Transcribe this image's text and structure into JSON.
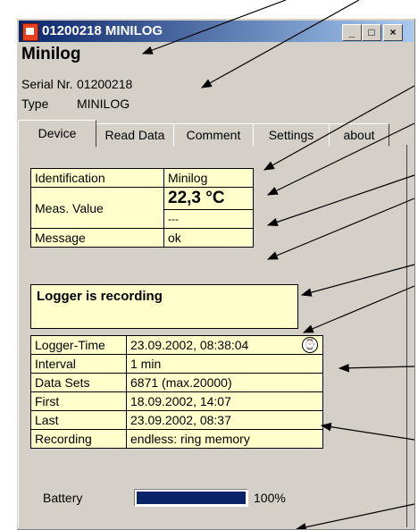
{
  "window": {
    "title": "01200218 MINILOG",
    "minimize": "_",
    "maximize": "□",
    "close": "×"
  },
  "header": {
    "name": "Minilog",
    "serial_label": "Serial Nr.",
    "serial_value": "01200218",
    "type_label": "Type",
    "type_value": "MINILOG"
  },
  "tabs": [
    "Device",
    "Read Data",
    "Comment",
    "Settings",
    "about"
  ],
  "device": {
    "identification_label": "Identification",
    "identification_value": "Minilog",
    "meas_label": "Meas. Value",
    "meas_value": "22,3 °C",
    "meas_value2": "---",
    "message_label": "Message",
    "message_value": "ok"
  },
  "status": "Logger is recording",
  "info_rows": [
    {
      "label": "Logger-Time",
      "value": "23.09.2002, 08:38:04"
    },
    {
      "label": "Interval",
      "value": "1 min"
    },
    {
      "label": "Data Sets",
      "value": "6871 (max.20000)"
    },
    {
      "label": "First",
      "value": "18.09.2002, 14:07"
    },
    {
      "label": "Last",
      "value": "23.09.2002, 08:37"
    },
    {
      "label": "Recording",
      "value": "endless: ring memory"
    }
  ],
  "battery": {
    "label": "Battery",
    "percent_text": "100%",
    "level": 1.0
  },
  "colors": {
    "title_bar": "#0a246a",
    "panel_bg": "#ffffcc",
    "progress": "#0a246a"
  }
}
